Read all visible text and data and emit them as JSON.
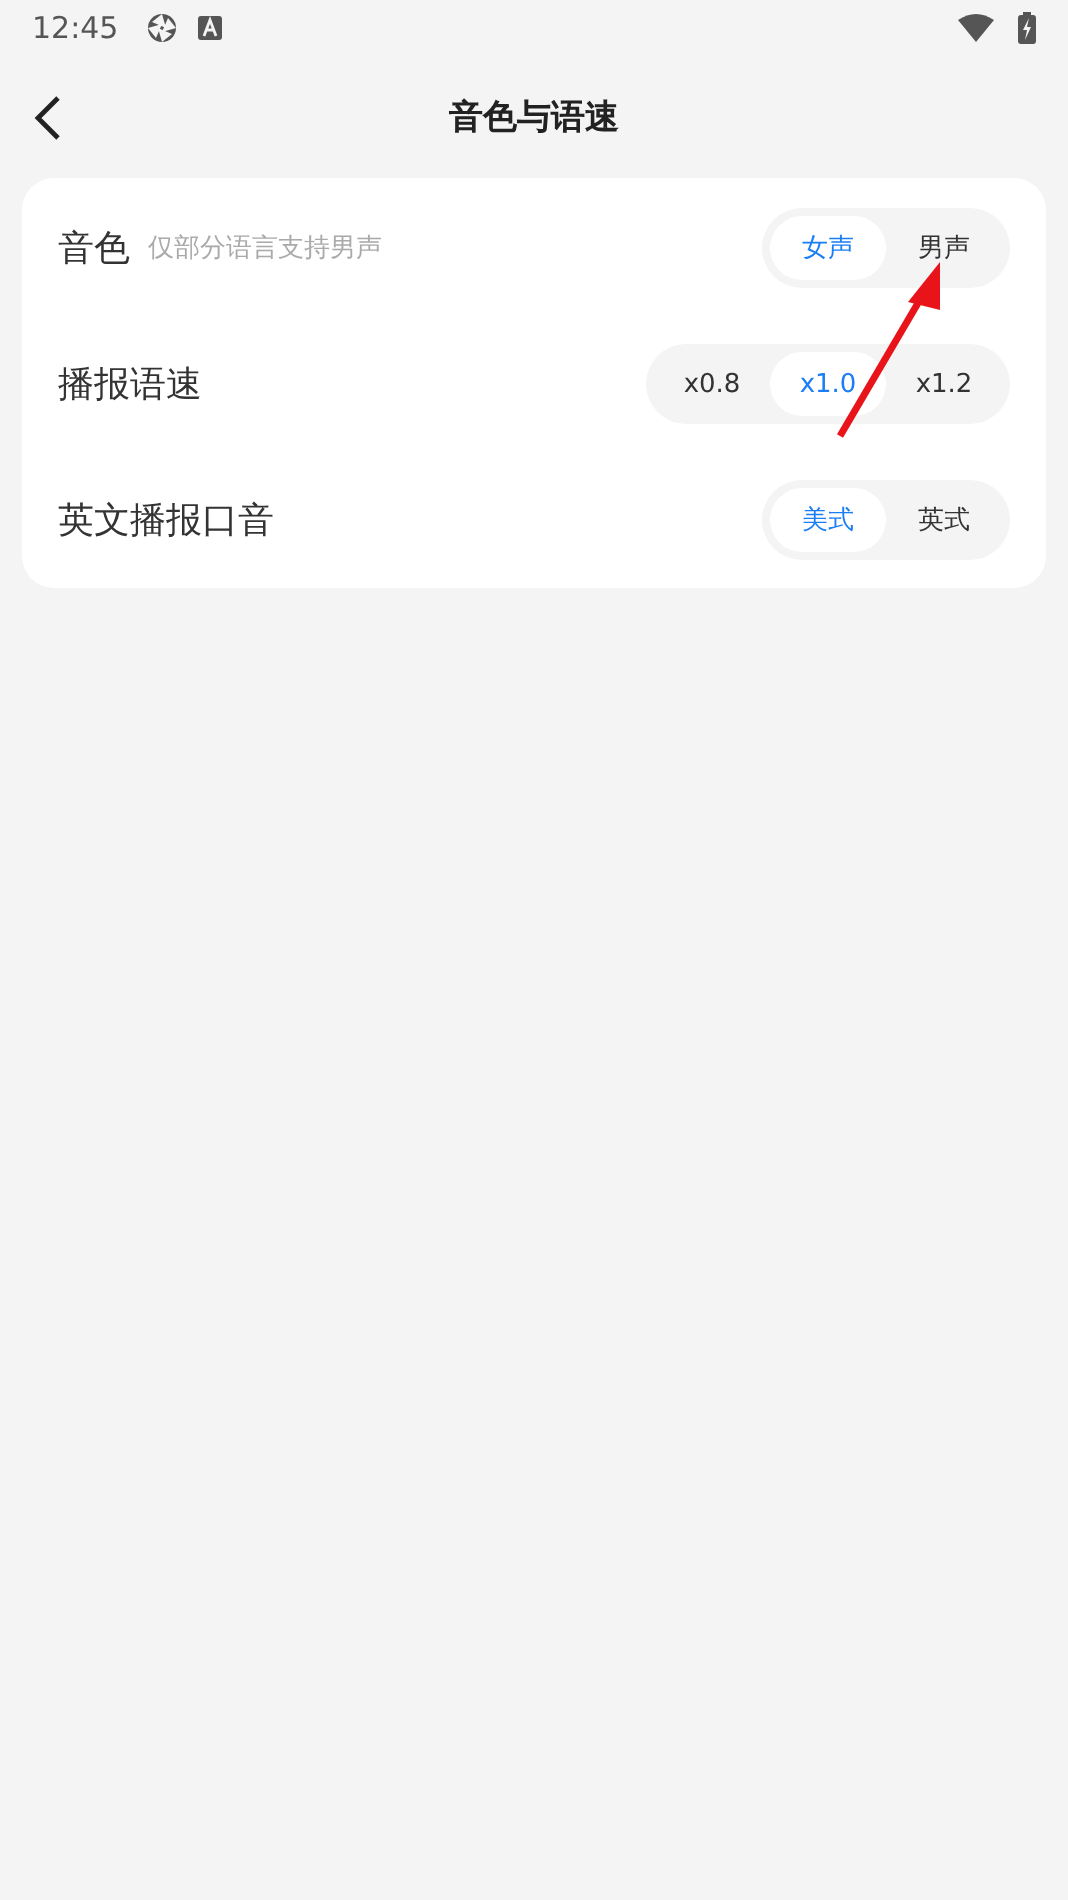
{
  "status_bar": {
    "time": "12:45"
  },
  "header": {
    "title": "音色与语速"
  },
  "settings": [
    {
      "label": "音色",
      "hint": "仅部分语言支持男声",
      "options": [
        {
          "label": "女声",
          "selected": true
        },
        {
          "label": "男声",
          "selected": false
        }
      ]
    },
    {
      "label": "播报语速",
      "options": [
        {
          "label": "x0.8",
          "selected": false
        },
        {
          "label": "x1.0",
          "selected": true
        },
        {
          "label": "x1.2",
          "selected": false
        }
      ]
    },
    {
      "label": "英文播报口音",
      "options": [
        {
          "label": "美式",
          "selected": true
        },
        {
          "label": "英式",
          "selected": false
        }
      ]
    }
  ]
}
